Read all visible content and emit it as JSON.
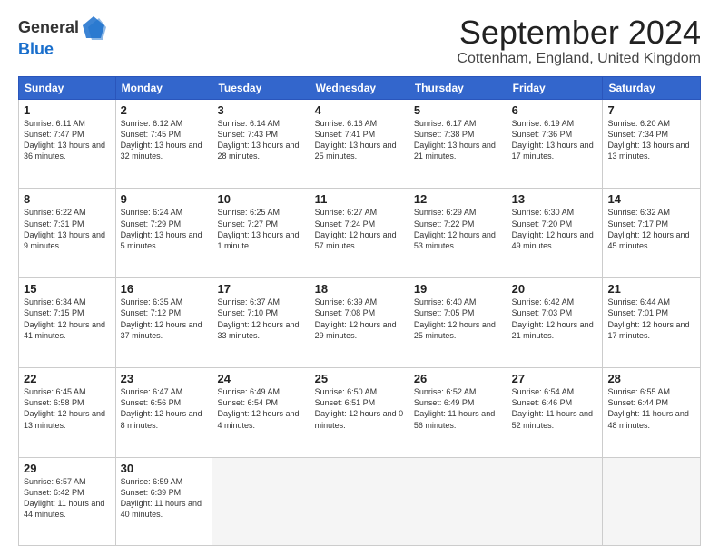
{
  "logo": {
    "general": "General",
    "blue": "Blue"
  },
  "header": {
    "month_title": "September 2024",
    "location": "Cottenham, England, United Kingdom"
  },
  "days_of_week": [
    "Sunday",
    "Monday",
    "Tuesday",
    "Wednesday",
    "Thursday",
    "Friday",
    "Saturday"
  ],
  "weeks": [
    [
      {
        "day": "1",
        "sunrise": "6:11 AM",
        "sunset": "7:47 PM",
        "daylight": "13 hours and 36 minutes."
      },
      {
        "day": "2",
        "sunrise": "6:12 AM",
        "sunset": "7:45 PM",
        "daylight": "13 hours and 32 minutes."
      },
      {
        "day": "3",
        "sunrise": "6:14 AM",
        "sunset": "7:43 PM",
        "daylight": "13 hours and 28 minutes."
      },
      {
        "day": "4",
        "sunrise": "6:16 AM",
        "sunset": "7:41 PM",
        "daylight": "13 hours and 25 minutes."
      },
      {
        "day": "5",
        "sunrise": "6:17 AM",
        "sunset": "7:38 PM",
        "daylight": "13 hours and 21 minutes."
      },
      {
        "day": "6",
        "sunrise": "6:19 AM",
        "sunset": "7:36 PM",
        "daylight": "13 hours and 17 minutes."
      },
      {
        "day": "7",
        "sunrise": "6:20 AM",
        "sunset": "7:34 PM",
        "daylight": "13 hours and 13 minutes."
      }
    ],
    [
      {
        "day": "8",
        "sunrise": "6:22 AM",
        "sunset": "7:31 PM",
        "daylight": "13 hours and 9 minutes."
      },
      {
        "day": "9",
        "sunrise": "6:24 AM",
        "sunset": "7:29 PM",
        "daylight": "13 hours and 5 minutes."
      },
      {
        "day": "10",
        "sunrise": "6:25 AM",
        "sunset": "7:27 PM",
        "daylight": "13 hours and 1 minute."
      },
      {
        "day": "11",
        "sunrise": "6:27 AM",
        "sunset": "7:24 PM",
        "daylight": "12 hours and 57 minutes."
      },
      {
        "day": "12",
        "sunrise": "6:29 AM",
        "sunset": "7:22 PM",
        "daylight": "12 hours and 53 minutes."
      },
      {
        "day": "13",
        "sunrise": "6:30 AM",
        "sunset": "7:20 PM",
        "daylight": "12 hours and 49 minutes."
      },
      {
        "day": "14",
        "sunrise": "6:32 AM",
        "sunset": "7:17 PM",
        "daylight": "12 hours and 45 minutes."
      }
    ],
    [
      {
        "day": "15",
        "sunrise": "6:34 AM",
        "sunset": "7:15 PM",
        "daylight": "12 hours and 41 minutes."
      },
      {
        "day": "16",
        "sunrise": "6:35 AM",
        "sunset": "7:12 PM",
        "daylight": "12 hours and 37 minutes."
      },
      {
        "day": "17",
        "sunrise": "6:37 AM",
        "sunset": "7:10 PM",
        "daylight": "12 hours and 33 minutes."
      },
      {
        "day": "18",
        "sunrise": "6:39 AM",
        "sunset": "7:08 PM",
        "daylight": "12 hours and 29 minutes."
      },
      {
        "day": "19",
        "sunrise": "6:40 AM",
        "sunset": "7:05 PM",
        "daylight": "12 hours and 25 minutes."
      },
      {
        "day": "20",
        "sunrise": "6:42 AM",
        "sunset": "7:03 PM",
        "daylight": "12 hours and 21 minutes."
      },
      {
        "day": "21",
        "sunrise": "6:44 AM",
        "sunset": "7:01 PM",
        "daylight": "12 hours and 17 minutes."
      }
    ],
    [
      {
        "day": "22",
        "sunrise": "6:45 AM",
        "sunset": "6:58 PM",
        "daylight": "12 hours and 13 minutes."
      },
      {
        "day": "23",
        "sunrise": "6:47 AM",
        "sunset": "6:56 PM",
        "daylight": "12 hours and 8 minutes."
      },
      {
        "day": "24",
        "sunrise": "6:49 AM",
        "sunset": "6:54 PM",
        "daylight": "12 hours and 4 minutes."
      },
      {
        "day": "25",
        "sunrise": "6:50 AM",
        "sunset": "6:51 PM",
        "daylight": "12 hours and 0 minutes."
      },
      {
        "day": "26",
        "sunrise": "6:52 AM",
        "sunset": "6:49 PM",
        "daylight": "11 hours and 56 minutes."
      },
      {
        "day": "27",
        "sunrise": "6:54 AM",
        "sunset": "6:46 PM",
        "daylight": "11 hours and 52 minutes."
      },
      {
        "day": "28",
        "sunrise": "6:55 AM",
        "sunset": "6:44 PM",
        "daylight": "11 hours and 48 minutes."
      }
    ],
    [
      {
        "day": "29",
        "sunrise": "6:57 AM",
        "sunset": "6:42 PM",
        "daylight": "11 hours and 44 minutes."
      },
      {
        "day": "30",
        "sunrise": "6:59 AM",
        "sunset": "6:39 PM",
        "daylight": "11 hours and 40 minutes."
      },
      null,
      null,
      null,
      null,
      null
    ]
  ]
}
